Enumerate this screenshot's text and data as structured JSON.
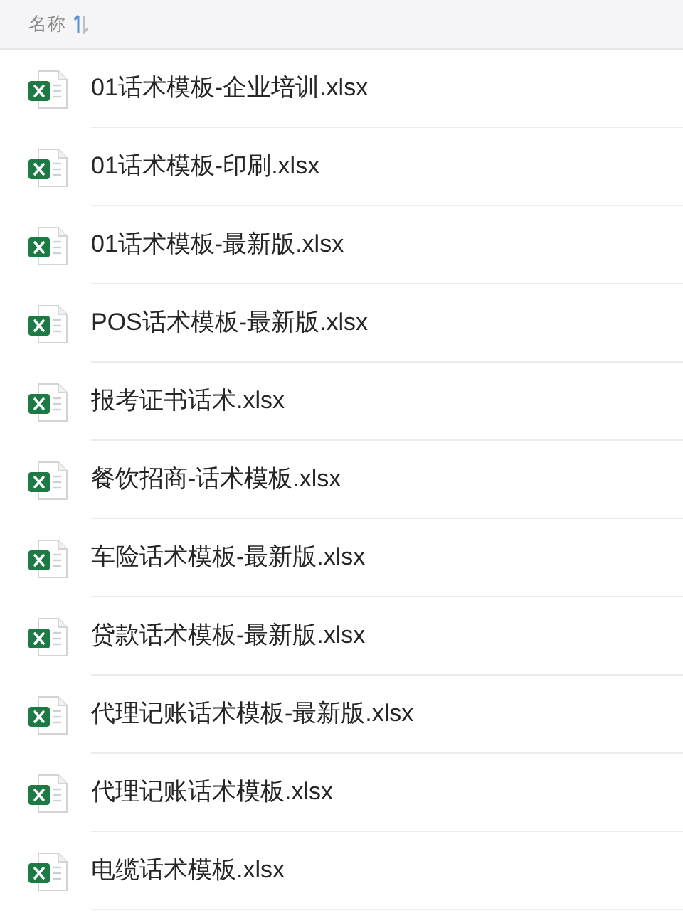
{
  "header": {
    "column_label": "名称"
  },
  "files": [
    {
      "name": "01话术模板-企业培训.xlsx"
    },
    {
      "name": "01话术模板-印刷.xlsx"
    },
    {
      "name": "01话术模板-最新版.xlsx"
    },
    {
      "name": "POS话术模板-最新版.xlsx"
    },
    {
      "name": "报考证书话术.xlsx"
    },
    {
      "name": "餐饮招商-话术模板.xlsx"
    },
    {
      "name": "车险话术模板-最新版.xlsx"
    },
    {
      "name": "贷款话术模板-最新版.xlsx"
    },
    {
      "name": "代理记账话术模板-最新版.xlsx"
    },
    {
      "name": "代理记账话术模板.xlsx"
    },
    {
      "name": "电缆话术模板.xlsx"
    }
  ]
}
